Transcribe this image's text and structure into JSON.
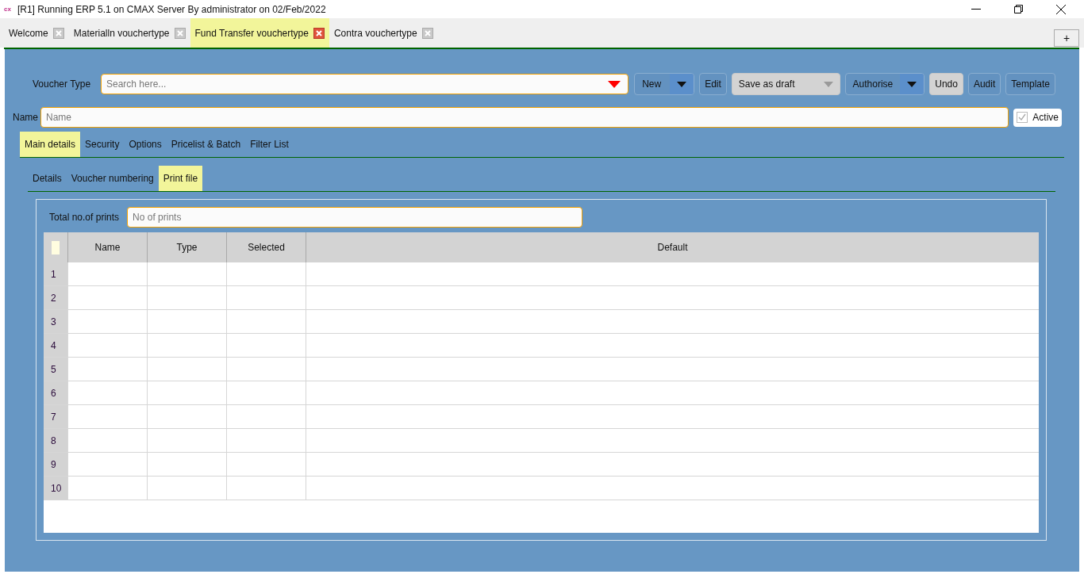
{
  "window": {
    "app_badge": "cx",
    "title": "[R1] Running ERP 5.1 on CMAX Server By administrator on 02/Feb/2022"
  },
  "doc_tabs": [
    {
      "label": "Welcome",
      "selected": false
    },
    {
      "label": "Materialln vouchertype",
      "selected": false
    },
    {
      "label": "Fund Transfer vouchertype",
      "selected": true
    },
    {
      "label": "Contra vouchertype",
      "selected": false
    }
  ],
  "add_tab": "+",
  "voucher_type": {
    "label": "Voucher Type",
    "placeholder": "Search here..."
  },
  "toolbar": [
    {
      "label": "New",
      "kind": "split",
      "disabled": false
    },
    {
      "label": "Edit",
      "kind": "plain",
      "disabled": false
    },
    {
      "label": "Save as draft",
      "kind": "dropdown",
      "disabled": true
    },
    {
      "label": "Authorise",
      "kind": "split",
      "disabled": false
    },
    {
      "label": "Undo",
      "kind": "plain",
      "disabled": true
    },
    {
      "label": "Audit",
      "kind": "plain",
      "disabled": false
    },
    {
      "label": "Template",
      "kind": "plain",
      "disabled": false
    }
  ],
  "name_field": {
    "label": "Name",
    "placeholder": "Name"
  },
  "active": {
    "label": "Active",
    "checked": true
  },
  "main_tabs": [
    {
      "label": "Main details",
      "selected": true
    },
    {
      "label": "Security",
      "selected": false
    },
    {
      "label": "Options",
      "selected": false
    },
    {
      "label": "Pricelist & Batch",
      "selected": false
    },
    {
      "label": "Filter List",
      "selected": false
    }
  ],
  "sub_tabs": [
    {
      "label": "Details",
      "selected": false
    },
    {
      "label": "Voucher numbering",
      "selected": false
    },
    {
      "label": "Print file",
      "selected": true
    }
  ],
  "prints": {
    "label": "Total no.of prints",
    "placeholder": "No of prints"
  },
  "table": {
    "columns": [
      "Name",
      "Type",
      "Selected",
      "Default"
    ],
    "rows": [
      "1",
      "2",
      "3",
      "4",
      "5",
      "6",
      "7",
      "8",
      "9",
      "10"
    ]
  }
}
